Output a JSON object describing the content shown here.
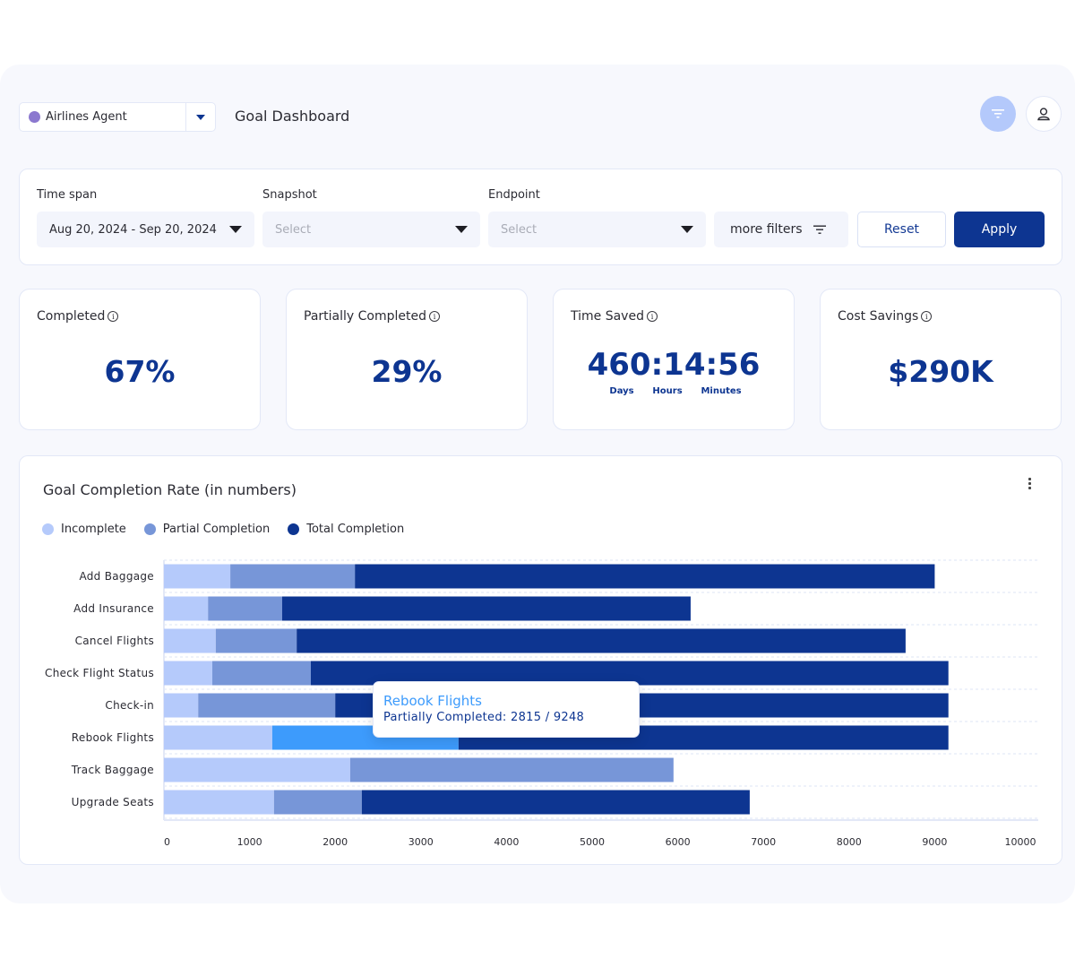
{
  "header": {
    "agent_name": "Airlines Agent",
    "agent_color": "#8b78cf",
    "page_title": "Goal Dashboard",
    "filter_icon": "filter-icon",
    "user_icon": "user-icon"
  },
  "filters": {
    "time_span": {
      "label": "Time span",
      "value": "Aug 20, 2024 - Sep 20, 2024"
    },
    "snapshot": {
      "label": "Snapshot",
      "placeholder": "Select"
    },
    "endpoint": {
      "label": "Endpoint",
      "placeholder": "Select"
    },
    "more_filters_label": "more filters",
    "reset_label": "Reset",
    "apply_label": "Apply"
  },
  "cards": [
    {
      "title": "Completed",
      "value": "67%"
    },
    {
      "title": "Partially Completed",
      "value": "29%"
    },
    {
      "title": "Time Saved",
      "value": "460:14:56",
      "units": [
        "Days",
        "Hours",
        "Minutes"
      ]
    },
    {
      "title": "Cost Savings",
      "value": "$290K"
    }
  ],
  "colors": {
    "incomplete": "#b5cafb",
    "partial": "#7796d8",
    "total": "#0d3591",
    "highlight": "#3d9bfc",
    "brand": "#0d3591"
  },
  "tooltip": {
    "title": "Rebook Flights",
    "body": "Partially Completed: 2815 / 9248"
  },
  "chart_data": {
    "type": "bar",
    "orientation": "horizontal",
    "stacked": true,
    "title": "Goal Completion Rate (in numbers)",
    "xlabel": "",
    "ylabel": "",
    "xlim": [
      0,
      10000
    ],
    "xticks": [
      0,
      1000,
      2000,
      3000,
      4000,
      5000,
      6000,
      7000,
      8000,
      9000,
      10000
    ],
    "grid": true,
    "legend_position": "top-left",
    "categories": [
      "Add Baggage",
      "Add Insurance",
      "Cancel Flights",
      "Check Flight Status",
      "Check-in",
      "Rebook Flights",
      "Track Baggage",
      "Upgrade Seats"
    ],
    "series": [
      {
        "name": "Incomplete",
        "values": [
          775,
          515,
          605,
          565,
          400,
          1265,
          2175,
          1285
        ]
      },
      {
        "name": "Partial Completion",
        "values": [
          1455,
          865,
          945,
          1150,
          1600,
          2175,
          3775,
          1025
        ]
      },
      {
        "name": "Total Completion",
        "values": [
          6770,
          4770,
          7110,
          7445,
          7160,
          5720,
          0,
          4530
        ]
      }
    ],
    "highlighted": {
      "category": "Rebook Flights",
      "series": "Partial Completion"
    }
  }
}
